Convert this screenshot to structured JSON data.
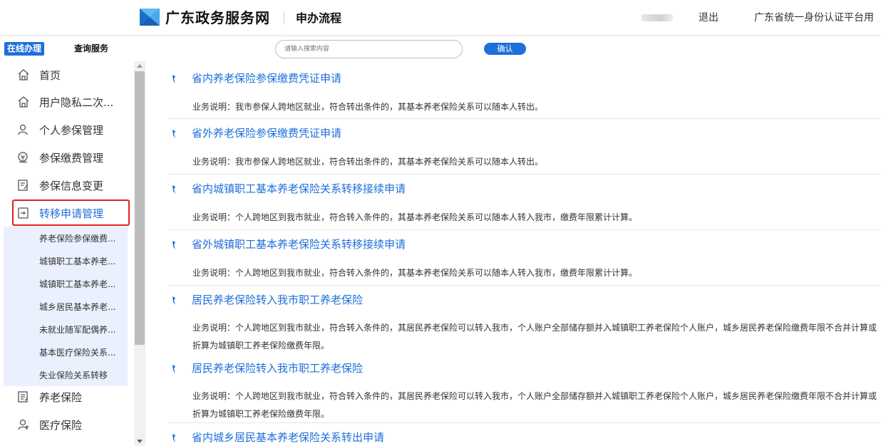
{
  "header": {
    "site_title": "广东政务服务网",
    "sub_title": "申办流程",
    "logout": "退出",
    "platform": "广东省统一身份认证平台用"
  },
  "tabs": {
    "online": "在线办理",
    "query": "查询服务"
  },
  "search": {
    "placeholder": "请输入搜索内容",
    "confirm": "确认"
  },
  "sidebar": {
    "items": [
      {
        "label": "首页",
        "icon": "home-icon"
      },
      {
        "label": "用户隐私二次...",
        "icon": "home-icon"
      },
      {
        "label": "个人参保管理",
        "icon": "user-icon"
      },
      {
        "label": "参保缴费管理",
        "icon": "payment-icon"
      },
      {
        "label": "参保信息变更",
        "icon": "edit-icon"
      },
      {
        "label": "转移申请管理",
        "icon": "transfer-icon"
      }
    ],
    "sub_items": [
      "养老保险参保缴费...",
      "城镇职工基本养老...",
      "城镇职工基本养老...",
      "城乡居民基本养老...",
      "未就业随军配偶养...",
      "基本医疗保险关系...",
      "失业保险关系转移"
    ],
    "bottom_items": [
      {
        "label": "养老保险",
        "icon": "document-icon"
      },
      {
        "label": "医疗保险",
        "icon": "medical-user-icon"
      }
    ],
    "accent_color": "#1e6fd9",
    "highlight_color": "#e02020"
  },
  "services": [
    {
      "title": "省内养老保险参保缴费凭证申请",
      "desc": "业务说明：我市参保人跨地区就业，符合转出条件的，其基本养老保险关系可以随本人转出。"
    },
    {
      "title": "省外养老保险参保缴费凭证申请",
      "desc": "业务说明：我市参保人跨地区就业，符合转出条件的，其基本养老保险关系可以随本人转出。"
    },
    {
      "title": "省内城镇职工基本养老保险关系转移接续申请",
      "desc": "业务说明：个人跨地区到我市就业，符合转入条件的，其基本养老保险关系可以随本人转入我市，缴费年限累计计算。"
    },
    {
      "title": "省外城镇职工基本养老保险关系转移接续申请",
      "desc": "业务说明：个人跨地区到我市就业，符合转入条件的，其基本养老保险关系可以随本人转入我市，缴费年限累计计算。"
    },
    {
      "title": "居民养老保险转入我市职工养老保险",
      "desc": "业务说明：个人跨地区到我市就业，符合转入条件的，其居民养老保险可以转入我市，个人账户全部储存额并入城镇职工养老保险个人账户，城乡居民养老保险缴费年限不合并计算或折算为城镇职工养老保险缴费年限。"
    },
    {
      "title": "居民养老保险转入我市职工养老保险",
      "desc": "业务说明：个人跨地区到我市就业，符合转入条件的，其居民养老保险可以转入我市，个人账户全部储存额并入城镇职工养老保险个人账户，城乡居民养老保险缴费年限不合并计算或折算为城镇职工养老保险缴费年限。"
    },
    {
      "title": "省内城乡居民基本养老保险关系转出申请",
      "desc": ""
    }
  ]
}
